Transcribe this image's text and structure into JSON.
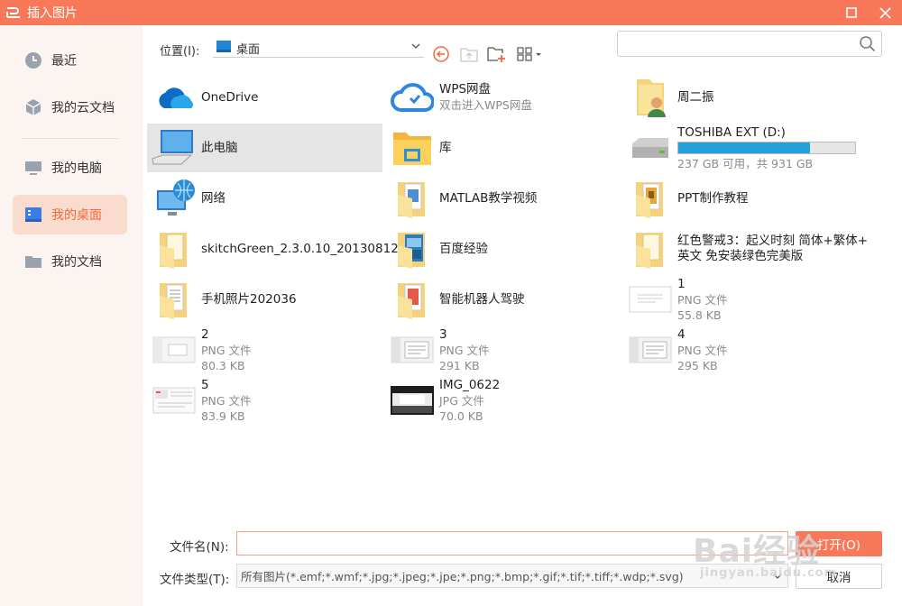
{
  "window": {
    "title": "插入图片",
    "brand_color": "#f7795a"
  },
  "sidebar": {
    "items": [
      {
        "label": "最近",
        "icon": "clock-icon"
      },
      {
        "label": "我的云文档",
        "icon": "cloud-cube-icon"
      },
      {
        "label": "我的电脑",
        "icon": "monitor-icon"
      },
      {
        "label": "我的桌面",
        "icon": "desktop-icon",
        "active": true
      },
      {
        "label": "我的文档",
        "icon": "folder-icon"
      }
    ]
  },
  "toolbar": {
    "location_label": "位置(I):",
    "location_value": "桌面",
    "search_placeholder": ""
  },
  "files": [
    {
      "name": "OneDrive",
      "sub": "",
      "icon": "onedrive-icon"
    },
    {
      "name": "WPS网盘",
      "sub": "双击进入WPS网盘",
      "icon": "wps-cloud-icon"
    },
    {
      "name": "周二振",
      "sub": "",
      "icon": "user-folder-icon"
    },
    {
      "name": "此电脑",
      "sub": "",
      "icon": "computer-icon",
      "selected": true
    },
    {
      "name": "库",
      "sub": "",
      "icon": "library-icon"
    },
    {
      "name": "TOSHIBA EXT (D:)",
      "sub": "237 GB 可用，共 931 GB",
      "icon": "drive-icon",
      "usage": 0.745
    },
    {
      "name": "网络",
      "sub": "",
      "icon": "network-icon"
    },
    {
      "name": "MATLAB教学视频",
      "sub": "",
      "icon": "folder-icon"
    },
    {
      "name": "PPT制作教程",
      "sub": "",
      "icon": "folder-icon"
    },
    {
      "name": "skitchGreen_2.3.0.10_20130812",
      "sub": "",
      "icon": "folder-icon"
    },
    {
      "name": "百度经验",
      "sub": "",
      "icon": "folder-icon"
    },
    {
      "name": "红色警戒3：起义时刻 简体+繁体+",
      "sub": "英文 免安装绿色完美版",
      "icon": "folder-icon"
    },
    {
      "name": "手机照片202036",
      "sub": "",
      "icon": "folder-icon"
    },
    {
      "name": "智能机器人驾驶",
      "sub": "",
      "icon": "folder-icon"
    },
    {
      "name": "1",
      "sub": "PNG 文件",
      "size": "55.8 KB",
      "icon": "image-thumb-icon"
    },
    {
      "name": "2",
      "sub": "PNG 文件",
      "size": "80.3 KB",
      "icon": "image-thumb-icon"
    },
    {
      "name": "3",
      "sub": "PNG 文件",
      "size": "291 KB",
      "icon": "image-thumb-icon"
    },
    {
      "name": "4",
      "sub": "PNG 文件",
      "size": "295 KB",
      "icon": "image-thumb-icon"
    },
    {
      "name": "5",
      "sub": "PNG 文件",
      "size": "83.9 KB",
      "icon": "image-thumb-icon"
    },
    {
      "name": "IMG_0622",
      "sub": "JPG 文件",
      "size": "70.0 KB",
      "icon": "photo-thumb-icon"
    }
  ],
  "bottom": {
    "filename_label": "文件名(N):",
    "filename_value": "",
    "filetype_label": "文件类型(T):",
    "filetype_value": "所有图片(*.emf;*.wmf;*.jpg;*.jpeg;*.jpe;*.png;*.bmp;*.gif;*.tif;*.tiff;*.wdp;*.svg)",
    "open_label": "打开(O)",
    "cancel_label": "取消"
  },
  "watermark": {
    "line1": "Bai经验",
    "line2": "jingyan.baidu.com"
  }
}
